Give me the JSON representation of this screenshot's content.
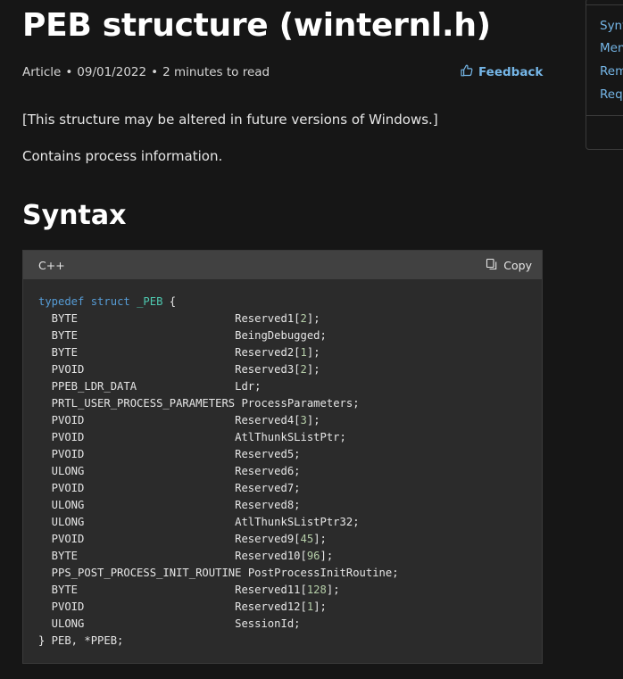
{
  "article": {
    "title": "PEB structure (winternl.h)",
    "meta_type": "Article",
    "meta_date": "09/01/2022",
    "meta_read": "2 minutes to read",
    "feedback_label": "Feedback",
    "notice": "[This structure may be altered in future versions of Windows.]",
    "description": "Contains process information.",
    "syntax_heading": "Syntax"
  },
  "code_block": {
    "language": "C++",
    "copy_label": "Copy",
    "open_kw1": "typedef",
    "open_kw2": "struct",
    "open_name": "_PEB",
    "open_brace": " {",
    "members": [
      {
        "type": "BYTE",
        "name": "Reserved1",
        "index": "2"
      },
      {
        "type": "BYTE",
        "name": "BeingDebugged",
        "index": ""
      },
      {
        "type": "BYTE",
        "name": "Reserved2",
        "index": "1"
      },
      {
        "type": "PVOID",
        "name": "Reserved3",
        "index": "2"
      },
      {
        "type": "PPEB_LDR_DATA",
        "name": "Ldr",
        "index": ""
      },
      {
        "type": "PRTL_USER_PROCESS_PARAMETERS",
        "name": "ProcessParameters",
        "index": ""
      },
      {
        "type": "PVOID",
        "name": "Reserved4",
        "index": "3"
      },
      {
        "type": "PVOID",
        "name": "AtlThunkSListPtr",
        "index": ""
      },
      {
        "type": "PVOID",
        "name": "Reserved5",
        "index": ""
      },
      {
        "type": "ULONG",
        "name": "Reserved6",
        "index": ""
      },
      {
        "type": "PVOID",
        "name": "Reserved7",
        "index": ""
      },
      {
        "type": "ULONG",
        "name": "Reserved8",
        "index": ""
      },
      {
        "type": "ULONG",
        "name": "AtlThunkSListPtr32",
        "index": ""
      },
      {
        "type": "PVOID",
        "name": "Reserved9",
        "index": "45"
      },
      {
        "type": "BYTE",
        "name": "Reserved10",
        "index": "96"
      },
      {
        "type": "PPS_POST_PROCESS_INIT_ROUTINE",
        "name": "PostProcessInitRoutine",
        "index": ""
      },
      {
        "type": "BYTE",
        "name": "Reserved11",
        "index": "128"
      },
      {
        "type": "PVOID",
        "name": "Reserved12",
        "index": "1"
      },
      {
        "type": "ULONG",
        "name": "SessionId",
        "index": ""
      }
    ],
    "close_line": "} PEB, *PPEB;"
  },
  "side_nav": {
    "items": [
      "Synt",
      "Mem",
      "Rem",
      "Requ"
    ]
  }
}
